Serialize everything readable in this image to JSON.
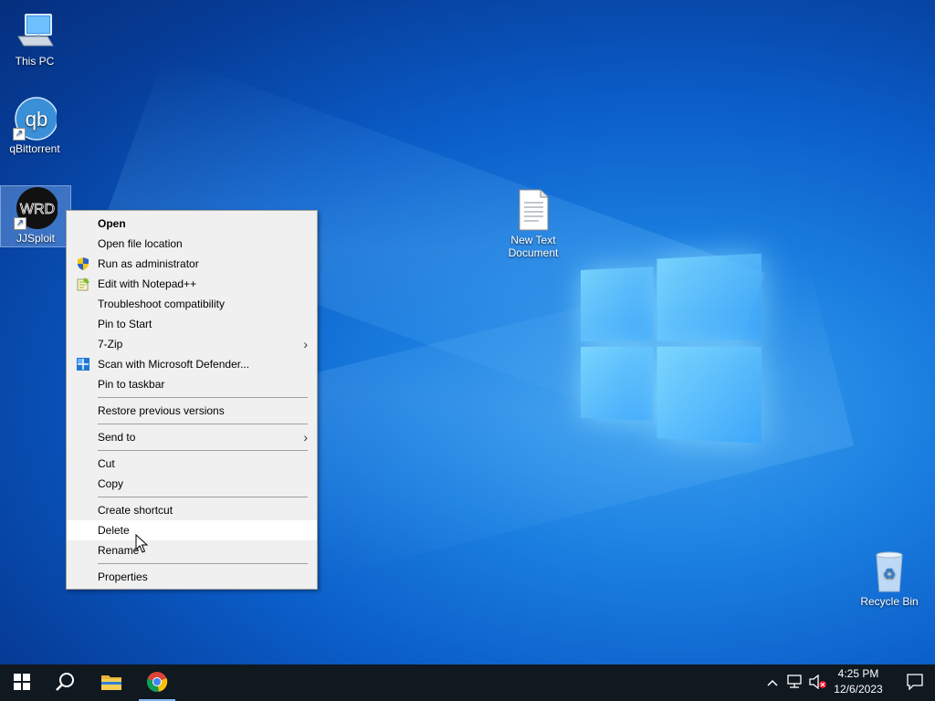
{
  "desktop": {
    "icons": [
      {
        "label": "This PC",
        "icon": "computer-icon"
      },
      {
        "label": "qBittorrent",
        "icon": "qbittorrent-icon"
      },
      {
        "label": "JJSploit",
        "icon": "jjsploit-icon"
      },
      {
        "label": "New Text Document",
        "icon": "text-document-icon"
      },
      {
        "label": "Recycle Bin",
        "icon": "recycle-bin-icon"
      }
    ]
  },
  "context_menu": {
    "items": [
      {
        "label": "Open",
        "bold": true
      },
      {
        "label": "Open file location"
      },
      {
        "label": "Run as administrator",
        "icon": "uac-shield-icon"
      },
      {
        "label": "Edit with Notepad++",
        "icon": "notepad-plus-plus-icon"
      },
      {
        "label": "Troubleshoot compatibility"
      },
      {
        "label": "Pin to Start"
      },
      {
        "label": "7-Zip",
        "submenu": true
      },
      {
        "label": "Scan with Microsoft Defender...",
        "icon": "defender-icon"
      },
      {
        "label": "Pin to taskbar"
      },
      {
        "label": "Restore previous versions"
      },
      {
        "label": "Send to",
        "submenu": true
      },
      {
        "label": "Cut"
      },
      {
        "label": "Copy"
      },
      {
        "label": "Create shortcut"
      },
      {
        "label": "Delete",
        "highlighted": true
      },
      {
        "label": "Rename"
      },
      {
        "label": "Properties"
      }
    ]
  },
  "taskbar": {
    "apps": [
      "start-icon",
      "search-icon",
      "file-explorer-icon",
      "chrome-icon"
    ],
    "active_app": "chrome-icon",
    "tray": [
      "chevron-up-icon",
      "network-icon",
      "volume-muted-icon"
    ],
    "clock_time": "4:25 PM",
    "clock_date": "12/6/2023"
  },
  "colors": {
    "desktop_blue": "#0a5bc6",
    "taskbar": "#101820",
    "menu_bg": "#f0f0f0",
    "menu_hover": "#ffffff"
  }
}
